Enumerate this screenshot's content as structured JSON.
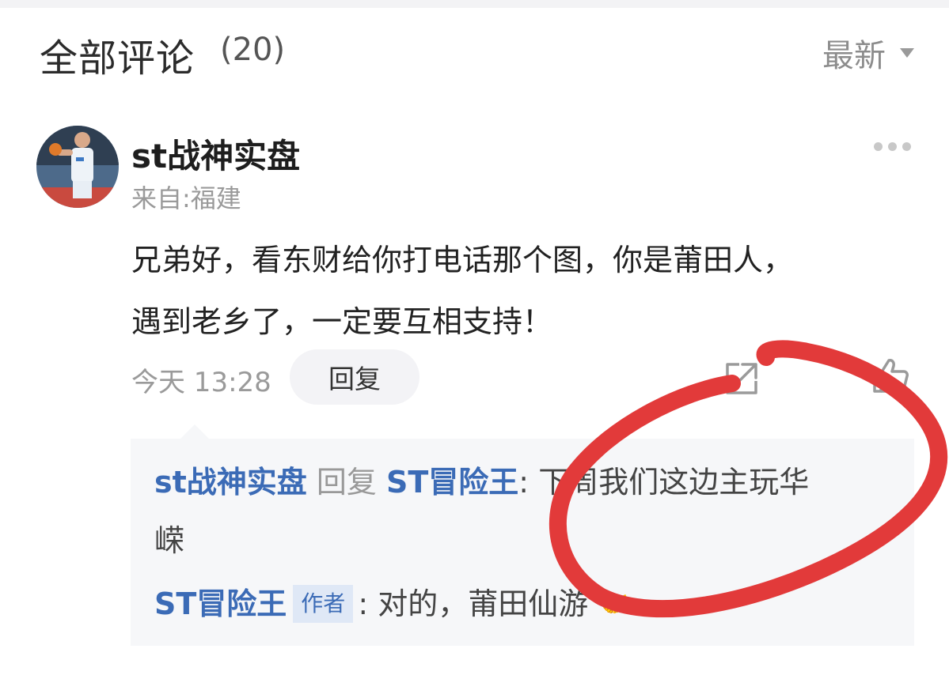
{
  "header": {
    "title": "全部评论",
    "count": "(20)",
    "sort_label": "最新"
  },
  "comment": {
    "username": "st战神实盘",
    "location": "来自:福建",
    "body_line1": "兄弟好，看东财给你打电话那个图，你是莆田人，",
    "body_line2": "遇到老乡了，一定要互相支持！",
    "timestamp": "今天 13:28",
    "reply_label": "回复",
    "avatar_icon": "basketball-player-avatar",
    "more_icon": "more-dots-icon",
    "share_icon": "share-icon",
    "like_icon": "thumbs-up-icon"
  },
  "replies": [
    {
      "from": "st战神实盘",
      "action": "回复",
      "to": "ST冒险王",
      "separator": ":",
      "text_line1": "下周我们这边主玩华",
      "text_line2": "嵘"
    },
    {
      "from": "ST冒险王",
      "badge": "作者",
      "separator": ":",
      "text": "对的，莆田仙游",
      "emoji": "🤝"
    }
  ],
  "colors": {
    "link_blue": "#3b6bb6",
    "annotation_red": "#e23a3a",
    "panel_bg": "#f6f7f9"
  }
}
